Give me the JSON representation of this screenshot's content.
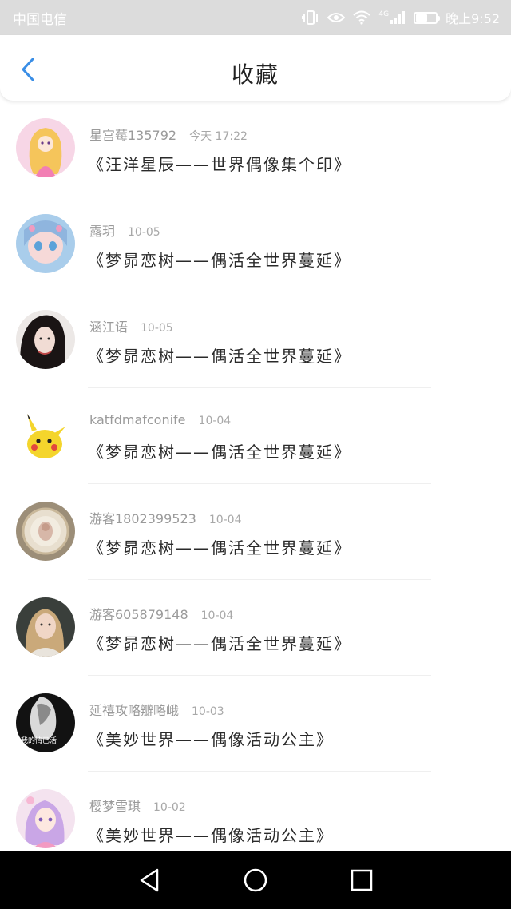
{
  "status_bar": {
    "carrier": "中国电信",
    "network": "4G",
    "time": "晚上9:52"
  },
  "header": {
    "title": "收藏"
  },
  "favorites": [
    {
      "user": "星宫莓135792",
      "time": "今天 17:22",
      "title": "《汪洋星辰——世界偶像集个印》"
    },
    {
      "user": "露玥",
      "time": "10-05",
      "title": "《梦昴恋树——偶活全世界蔓延》"
    },
    {
      "user": "涵江语",
      "time": "10-05",
      "title": "《梦昴恋树——偶活全世界蔓延》"
    },
    {
      "user": "katfdmafconife",
      "time": "10-04",
      "title": "《梦昴恋树——偶活全世界蔓延》"
    },
    {
      "user": "游客1802399523",
      "time": "10-04",
      "title": "《梦昴恋树——偶活全世界蔓延》"
    },
    {
      "user": "游客605879148",
      "time": "10-04",
      "title": "《梦昴恋树——偶活全世界蔓延》"
    },
    {
      "user": "延禧攻略瓣略峨",
      "time": "10-03",
      "title": "《美妙世界——偶像活动公主》"
    },
    {
      "user": "樱梦雪琪",
      "time": "10-02",
      "title": "《美妙世界——偶像活动公主》"
    }
  ],
  "avatar_text": {
    "row7": "我的情已活"
  },
  "colors": {
    "accent": "#3a8ee6",
    "status_bar_bg": "#dcdcdc",
    "system_nav_bg": "#000000"
  },
  "icons": {
    "back": "chevron-left-icon",
    "nav_back": "triangle-back-icon",
    "nav_home": "circle-home-icon",
    "nav_recents": "square-recents-icon"
  }
}
